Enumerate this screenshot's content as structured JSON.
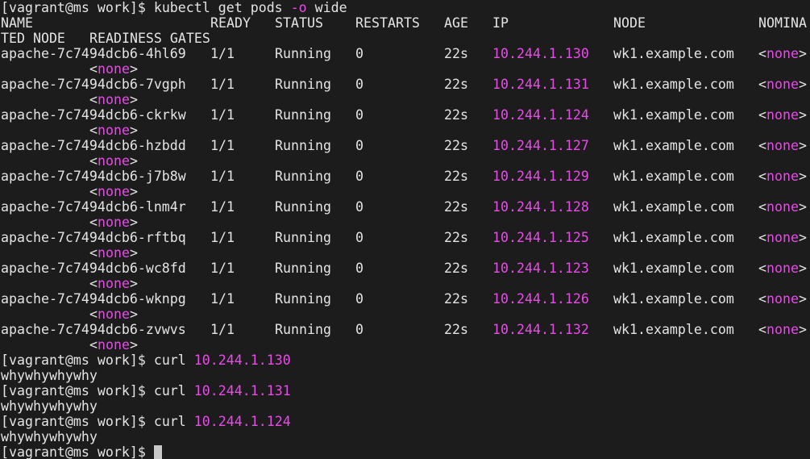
{
  "prompt": "[vagrant@ms work]$",
  "first_command": {
    "cmd": "kubectl get pods",
    "flag": "-o",
    "arg": "wide"
  },
  "headers": {
    "name": "NAME",
    "ready": "READY",
    "status": "STATUS",
    "restarts": "RESTARTS",
    "age": "AGE",
    "ip": "IP",
    "node": "NODE",
    "nominated_head": "NOMINA",
    "nominated_tail": "TED NODE",
    "readiness_gates": "READINESS GATES"
  },
  "pods": [
    {
      "name": "apache-7c7494dcb6-4hl69",
      "ready": "1/1",
      "status": "Running",
      "restarts": "0",
      "age": "22s",
      "ip": "10.244.1.130",
      "node": "wk1.example.com",
      "nominated": "none",
      "gates": "none"
    },
    {
      "name": "apache-7c7494dcb6-7vgph",
      "ready": "1/1",
      "status": "Running",
      "restarts": "0",
      "age": "22s",
      "ip": "10.244.1.131",
      "node": "wk1.example.com",
      "nominated": "none",
      "gates": "none"
    },
    {
      "name": "apache-7c7494dcb6-ckrkw",
      "ready": "1/1",
      "status": "Running",
      "restarts": "0",
      "age": "22s",
      "ip": "10.244.1.124",
      "node": "wk1.example.com",
      "nominated": "none",
      "gates": "none"
    },
    {
      "name": "apache-7c7494dcb6-hzbdd",
      "ready": "1/1",
      "status": "Running",
      "restarts": "0",
      "age": "22s",
      "ip": "10.244.1.127",
      "node": "wk1.example.com",
      "nominated": "none",
      "gates": "none"
    },
    {
      "name": "apache-7c7494dcb6-j7b8w",
      "ready": "1/1",
      "status": "Running",
      "restarts": "0",
      "age": "22s",
      "ip": "10.244.1.129",
      "node": "wk1.example.com",
      "nominated": "none",
      "gates": "none"
    },
    {
      "name": "apache-7c7494dcb6-lnm4r",
      "ready": "1/1",
      "status": "Running",
      "restarts": "0",
      "age": "22s",
      "ip": "10.244.1.128",
      "node": "wk1.example.com",
      "nominated": "none",
      "gates": "none"
    },
    {
      "name": "apache-7c7494dcb6-rftbq",
      "ready": "1/1",
      "status": "Running",
      "restarts": "0",
      "age": "22s",
      "ip": "10.244.1.125",
      "node": "wk1.example.com",
      "nominated": "none",
      "gates": "none"
    },
    {
      "name": "apache-7c7494dcb6-wc8fd",
      "ready": "1/1",
      "status": "Running",
      "restarts": "0",
      "age": "22s",
      "ip": "10.244.1.123",
      "node": "wk1.example.com",
      "nominated": "none",
      "gates": "none"
    },
    {
      "name": "apache-7c7494dcb6-wknpg",
      "ready": "1/1",
      "status": "Running",
      "restarts": "0",
      "age": "22s",
      "ip": "10.244.1.126",
      "node": "wk1.example.com",
      "nominated": "none",
      "gates": "none"
    },
    {
      "name": "apache-7c7494dcb6-zvwvs",
      "ready": "1/1",
      "status": "Running",
      "restarts": "0",
      "age": "22s",
      "ip": "10.244.1.132",
      "node": "wk1.example.com",
      "nominated": "none",
      "gates": "none"
    }
  ],
  "curls": [
    {
      "cmd": "curl",
      "ip": "10.244.1.130",
      "output": "whywhywhywhy"
    },
    {
      "cmd": "curl",
      "ip": "10.244.1.131",
      "output": "whywhywhywhy"
    },
    {
      "cmd": "curl",
      "ip": "10.244.1.124",
      "output": "whywhywhywhy"
    }
  ],
  "colors": {
    "background": "#1c1c1c",
    "foreground": "#e4e4e4",
    "highlight": "#e84be8",
    "cursor": "#c8c8c8"
  }
}
